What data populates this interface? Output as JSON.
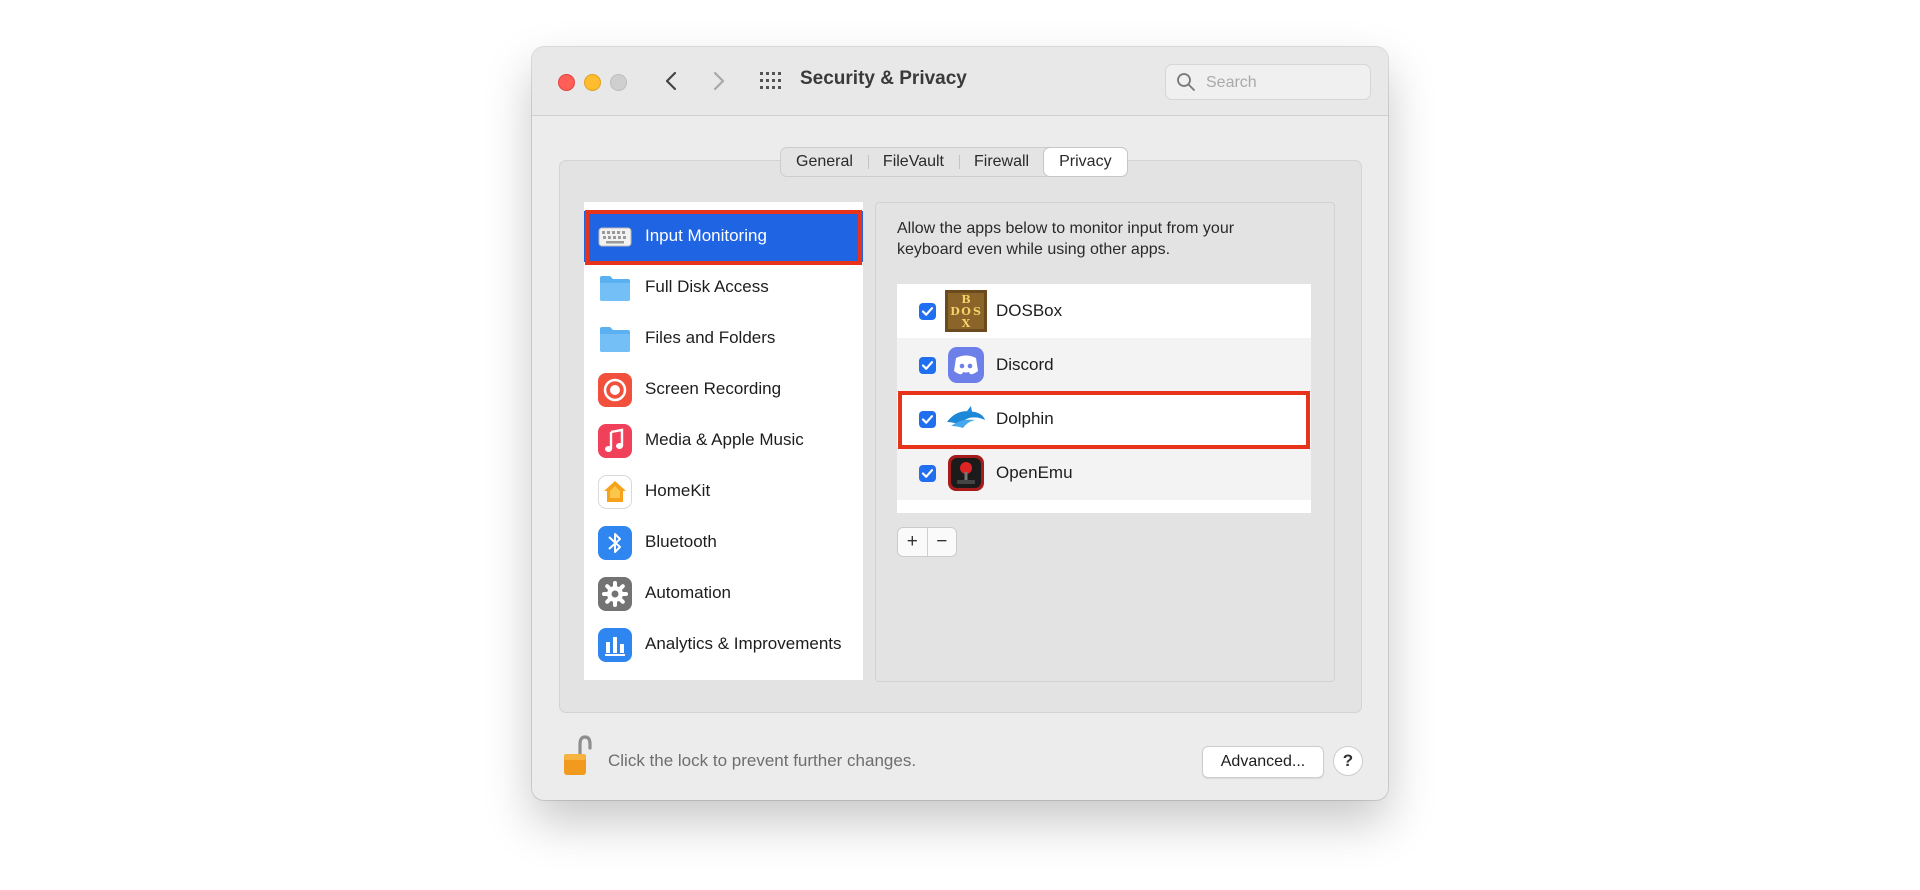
{
  "window": {
    "title": "Security & Privacy"
  },
  "search": {
    "placeholder": "Search"
  },
  "tabs": [
    {
      "label": "General",
      "active": false
    },
    {
      "label": "FileVault",
      "active": false
    },
    {
      "label": "Firewall",
      "active": false
    },
    {
      "label": "Privacy",
      "active": true
    }
  ],
  "sidebar": {
    "items": [
      {
        "label": "Input Monitoring",
        "icon": "keyboard-icon",
        "selected": true
      },
      {
        "label": "Full Disk Access",
        "icon": "folder-icon"
      },
      {
        "label": "Files and Folders",
        "icon": "folder-icon"
      },
      {
        "label": "Screen Recording",
        "icon": "screen-recording-icon"
      },
      {
        "label": "Media & Apple Music",
        "icon": "music-note-icon"
      },
      {
        "label": "HomeKit",
        "icon": "homekit-icon"
      },
      {
        "label": "Bluetooth",
        "icon": "bluetooth-icon"
      },
      {
        "label": "Automation",
        "icon": "gear-icon"
      },
      {
        "label": "Analytics & Improvements",
        "icon": "bar-chart-icon"
      }
    ]
  },
  "main": {
    "description": "Allow the apps below to monitor input from your keyboard even while using other apps.",
    "apps": [
      {
        "name": "DOSBox",
        "checked": true,
        "icon": "dosbox-icon"
      },
      {
        "name": "Discord",
        "checked": true,
        "icon": "discord-icon"
      },
      {
        "name": "Dolphin",
        "checked": true,
        "icon": "dolphin-icon",
        "highlighted": true
      },
      {
        "name": "OpenEmu",
        "checked": true,
        "icon": "openemu-icon"
      }
    ],
    "add_label": "+",
    "remove_label": "−"
  },
  "footer": {
    "lock_text": "Click the lock to prevent further changes.",
    "advanced_label": "Advanced...",
    "help_label": "?"
  },
  "colors": {
    "selection": "#1f64e3",
    "highlight_outline": "#e8331b",
    "checkbox": "#1f6ff0"
  }
}
